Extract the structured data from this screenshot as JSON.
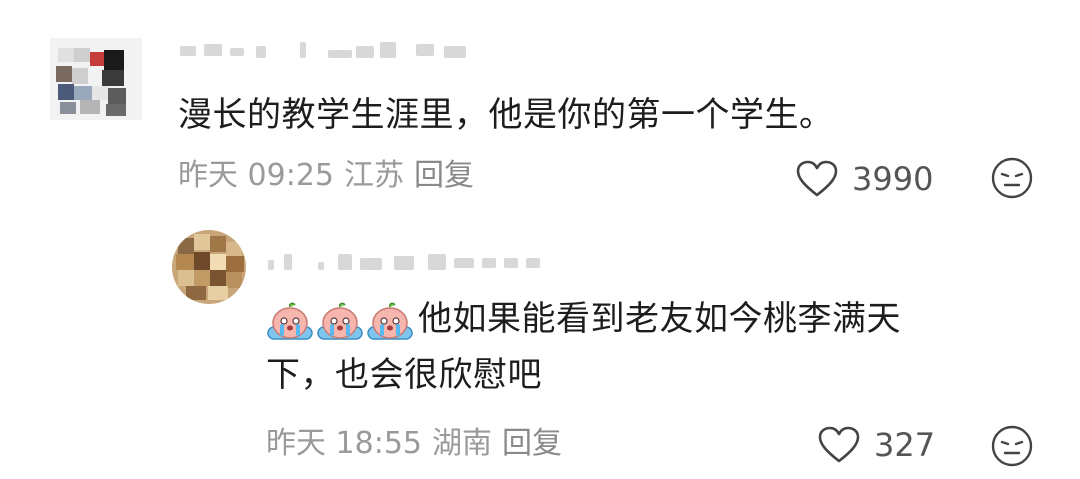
{
  "comments": [
    {
      "text": "漫长的教学生涯里，他是你的第一个学生。",
      "time": "昨天 09:25",
      "location": "江苏",
      "reply_label": "回复",
      "likes": "3990"
    },
    {
      "emojis": [
        "cry-emoji",
        "cry-emoji",
        "cry-emoji"
      ],
      "text_line1": "他如果能看到老友如今桃李满天",
      "text_line2": "下，也会很欣慰吧",
      "time": "昨天 18:55",
      "location": "湖南",
      "reply_label": "回复",
      "likes": "327"
    }
  ],
  "colors": {
    "meta_gray": "#9a9a9a",
    "count_gray": "#555555",
    "icon_gray": "#444444"
  }
}
